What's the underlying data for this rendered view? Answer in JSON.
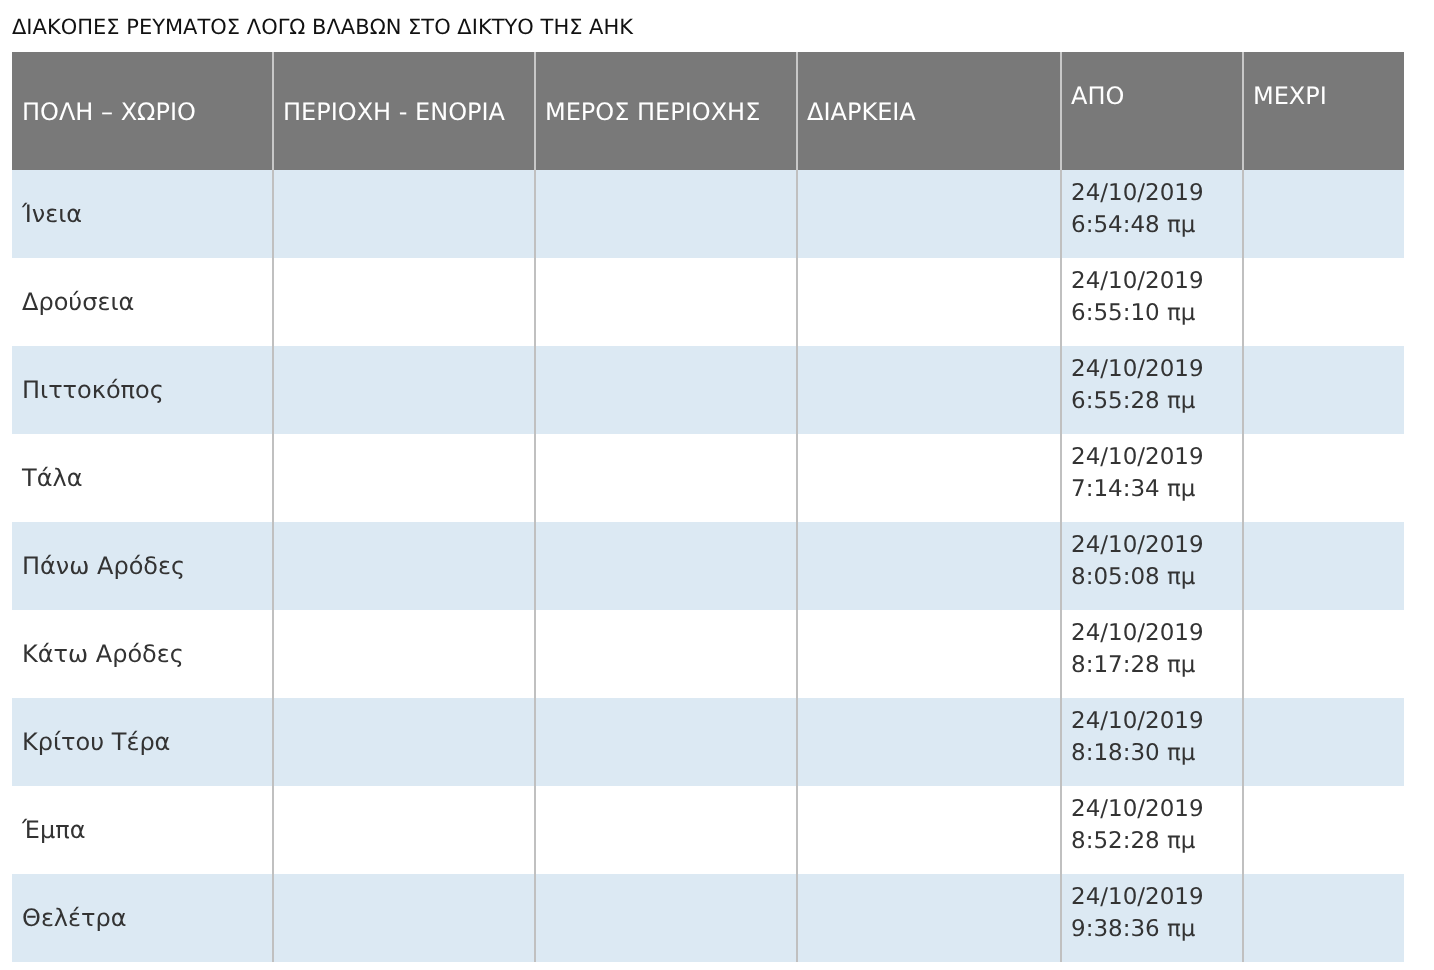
{
  "title": "ΔΙΑΚΟΠΕΣ ΡΕΥΜΑΤΟΣ ΛΟΓΩ ΒΛΑΒΩΝ ΣΤΟ ΔΙΚΤΥΟ ΤΗΣ ΑΗΚ",
  "table": {
    "columns": [
      "ΠΟΛΗ – ΧΩΡΙΟ",
      "ΠΕΡΙΟΧΗ - ΕΝΟΡΙΑ",
      "ΜΕΡΟΣ ΠΕΡΙΟΧΗΣ",
      "ΔΙΑΡΚΕΙΑ",
      "ΑΠΟ",
      "ΜΕΧΡΙ"
    ],
    "rows": [
      {
        "place": "Ίνεια",
        "from_date": "24/10/2019",
        "from_time": "6:54:48 πμ"
      },
      {
        "place": "Δρούσεια",
        "from_date": "24/10/2019",
        "from_time": "6:55:10 πμ"
      },
      {
        "place": "Πιττοκόπος",
        "from_date": "24/10/2019",
        "from_time": "6:55:28 πμ"
      },
      {
        "place": "Τάλα",
        "from_date": "24/10/2019",
        "from_time": "7:14:34 πμ"
      },
      {
        "place": "Πάνω Αρόδες",
        "from_date": "24/10/2019",
        "from_time": "8:05:08 πμ"
      },
      {
        "place": "Κάτω Αρόδες",
        "from_date": "24/10/2019",
        "from_time": "8:17:28 πμ"
      },
      {
        "place": "Κρίτου Τέρα",
        "from_date": "24/10/2019",
        "from_time": "8:18:30 πμ"
      },
      {
        "place": "Έμπα",
        "from_date": "24/10/2019",
        "from_time": "8:52:28 πμ"
      },
      {
        "place": "Θελέτρα",
        "from_date": "24/10/2019",
        "from_time": "9:38:36 πμ"
      }
    ]
  }
}
